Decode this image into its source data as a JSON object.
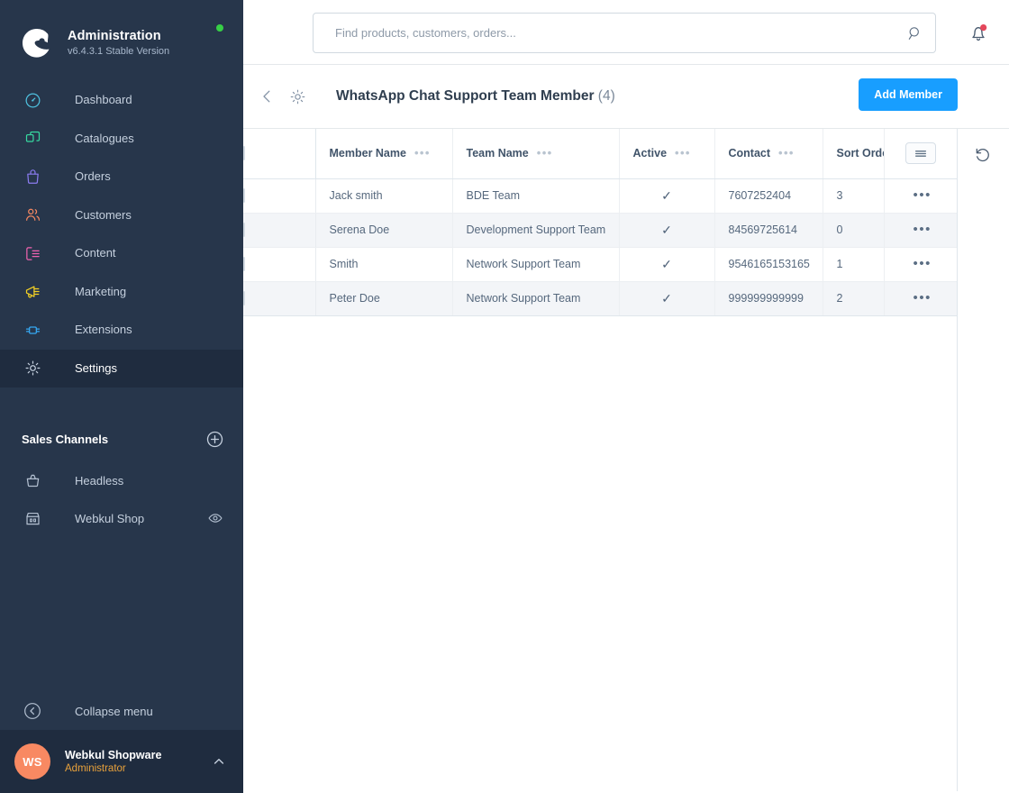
{
  "sidebar": {
    "brand": {
      "logo_icon": "shopware-logo-icon",
      "title": "Administration",
      "version": "v6.4.3.1 Stable Version",
      "status_dot_color": "#37d046"
    },
    "nav": [
      {
        "label": "Dashboard",
        "icon": "dashboard-gauge-icon",
        "color": "#4fc2e0",
        "active": false
      },
      {
        "label": "Catalogues",
        "icon": "catalogues-stack-icon",
        "color": "#37d9a0",
        "active": false
      },
      {
        "label": "Orders",
        "icon": "orders-bag-icon",
        "color": "#8b7cf0",
        "active": false
      },
      {
        "label": "Customers",
        "icon": "customers-people-icon",
        "color": "#f88962",
        "active": false
      },
      {
        "label": "Content",
        "icon": "content-layout-icon",
        "color": "#f062b0",
        "active": false
      },
      {
        "label": "Marketing",
        "icon": "marketing-megaphone-icon",
        "color": "#f2d024",
        "active": false
      },
      {
        "label": "Extensions",
        "icon": "extensions-plug-icon",
        "color": "#36a9f4",
        "active": false
      },
      {
        "label": "Settings",
        "icon": "settings-gear-icon",
        "color": "#c5d0de",
        "active": true
      }
    ],
    "sales_channels": {
      "title": "Sales Channels",
      "add_icon": "plus-circle-icon",
      "items": [
        {
          "label": "Headless",
          "icon": "headless-basket-icon",
          "trailing_icon": ""
        },
        {
          "label": "Webkul Shop",
          "icon": "storefront-icon",
          "trailing_icon": "eye-icon"
        }
      ]
    },
    "collapse": {
      "label": "Collapse menu",
      "icon": "collapse-chevron-circle-icon"
    },
    "user": {
      "initials": "WS",
      "name": "Webkul Shopware",
      "role": "Administrator",
      "caret_icon": "chevron-up-icon",
      "avatar_color": "#f88962"
    }
  },
  "topbar": {
    "search": {
      "placeholder": "Find products, customers, orders...",
      "value": "",
      "icon": "search-icon"
    },
    "notifications": {
      "icon": "bell-icon",
      "has_badge": true,
      "badge_color": "#e4475b"
    }
  },
  "page_header": {
    "back_icon": "chevron-left-icon",
    "settings_icon": "gear-icon",
    "title": "WhatsApp Chat Support Team Member",
    "count": "(4)",
    "primary_button": {
      "label": "Add Member",
      "color": "#189eff"
    }
  },
  "grid": {
    "select_all_checkbox": false,
    "columns_button_icon": "columns-settings-icon",
    "refresh_icon": "refresh-reset-icon",
    "column_menu_icon": "column-options-dots",
    "row_menu_icon": "row-context-dots",
    "active_tick_icon": "check-icon",
    "columns": [
      {
        "key": "member_name",
        "label": "Member Name",
        "has_menu": true
      },
      {
        "key": "team_name",
        "label": "Team Name",
        "has_menu": true
      },
      {
        "key": "active",
        "label": "Active",
        "has_menu": true
      },
      {
        "key": "contact",
        "label": "Contact",
        "has_menu": true
      },
      {
        "key": "sort_order",
        "label": "Sort Order",
        "has_menu": false
      }
    ],
    "rows": [
      {
        "member_name": "Jack smith",
        "team_name": "BDE Team",
        "active": true,
        "contact": "7607252404",
        "sort_order": "3"
      },
      {
        "member_name": "Serena Doe",
        "team_name": "Development Support Team",
        "active": true,
        "contact": "84569725614",
        "sort_order": "0"
      },
      {
        "member_name": "Smith",
        "team_name": "Network Support Team",
        "active": true,
        "contact": "9546165153165",
        "sort_order": "1"
      },
      {
        "member_name": "Peter Doe",
        "team_name": "Network Support Team",
        "active": true,
        "contact": "999999999999",
        "sort_order": "2"
      }
    ]
  }
}
